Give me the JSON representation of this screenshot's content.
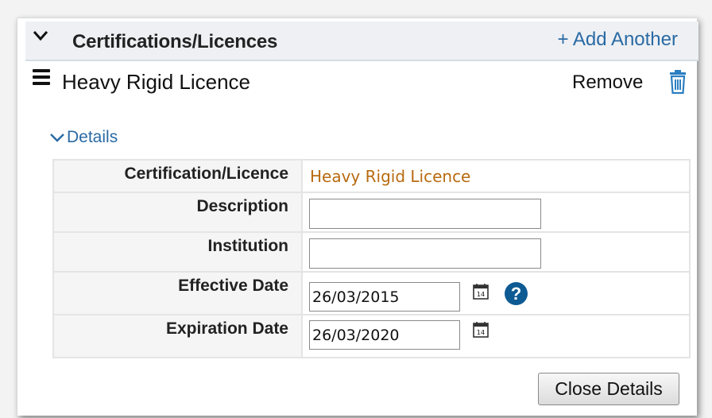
{
  "header": {
    "title": "Certifications/Licences",
    "add_link": "+ Add Another"
  },
  "item": {
    "title": "Heavy Rigid Licence",
    "remove_label": "Remove"
  },
  "details": {
    "toggle_label": "Details",
    "rows": {
      "certification": {
        "label": "Certification/Licence",
        "value": "Heavy Rigid Licence"
      },
      "description": {
        "label": "Description",
        "value": ""
      },
      "institution": {
        "label": "Institution",
        "value": ""
      },
      "effective_date": {
        "label": "Effective Date",
        "value": "26/03/2015",
        "calendar_number": "14"
      },
      "expiration_date": {
        "label": "Expiration Date",
        "value": "26/03/2020",
        "calendar_number": "14"
      }
    },
    "help_symbol": "?",
    "close_label": "Close Details"
  },
  "colors": {
    "link": "#2a6aa3",
    "value_text": "#b86a10",
    "header_bg": "#eef0f4",
    "help_bg": "#0e5a93"
  },
  "icons": [
    "chevron-down-icon",
    "hamburger-menu-icon",
    "trash-icon",
    "chevron-down-small-icon",
    "calendar-icon",
    "help-icon"
  ]
}
